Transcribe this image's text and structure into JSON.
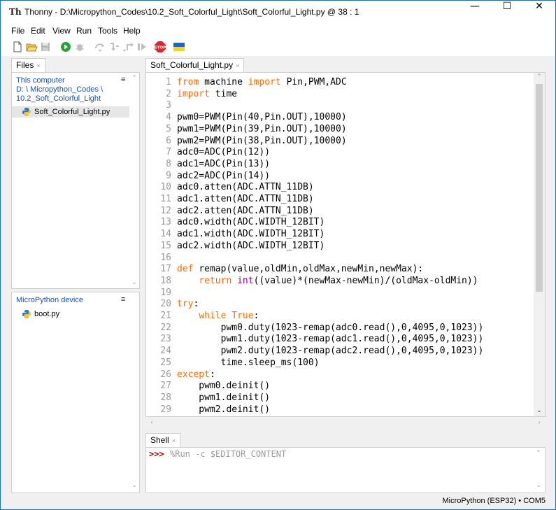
{
  "window": {
    "title": "Thonny  -  D:\\Micropython_Codes\\10.2_Soft_Colorful_Light\\Soft_Colorful_Light.py  @  38 : 1",
    "app_icon_text": "Th",
    "controls": {
      "minimize": "—",
      "maximize": "☐",
      "close": "✕"
    }
  },
  "menu": [
    "File",
    "Edit",
    "View",
    "Run",
    "Tools",
    "Help"
  ],
  "toolbar": {
    "icons": [
      "new-file-icon",
      "open-file-icon",
      "save-file-icon",
      "run-icon",
      "debug-icon",
      "step-over-icon",
      "step-into-icon",
      "step-out-icon",
      "resume-icon",
      "stop-icon",
      "ukraine-flag-icon"
    ],
    "stop_label": "STOP"
  },
  "colors": {
    "accent": "#1c4fa8",
    "keyword": "#ff6a00",
    "builtin": "#7700aa",
    "prompt": "#8b0000",
    "stop": "#d9262c"
  },
  "files_panel": {
    "tab_label": "Files",
    "tab_close": "×",
    "computer_section": {
      "title": "This computer",
      "path_line1": "D: \\ Micropython_Codes \\",
      "path_line2": "10.2_Soft_Colorful_Light",
      "files": [
        "Soft_Colorful_Light.py"
      ]
    },
    "device_section": {
      "title": "MicroPython device",
      "files": [
        "boot.py"
      ]
    },
    "menu_glyph": "≡"
  },
  "editor": {
    "tab_label": "Soft_Colorful_Light.py",
    "tab_close": "×",
    "line_numbers": [
      "1",
      "2",
      "3",
      "4",
      "5",
      "6",
      "7",
      "8",
      "9",
      "10",
      "11",
      "12",
      "13",
      "14",
      "15",
      "16",
      "17",
      "18",
      "19",
      "20",
      "21",
      "22",
      "23",
      "24",
      "25",
      "26",
      "27",
      "28",
      "29"
    ],
    "lines": [
      "from machine import Pin,PWM,ADC",
      "import time",
      "",
      "pwm0=PWM(Pin(40,Pin.OUT),10000)",
      "pwm1=PWM(Pin(39,Pin.OUT),10000)",
      "pwm2=PWM(Pin(38,Pin.OUT),10000)",
      "adc0=ADC(Pin(12))",
      "adc1=ADC(Pin(13))",
      "adc2=ADC(Pin(14))",
      "adc0.atten(ADC.ATTN_11DB)",
      "adc1.atten(ADC.ATTN_11DB)",
      "adc2.atten(ADC.ATTN_11DB)",
      "adc0.width(ADC.WIDTH_12BIT)",
      "adc1.width(ADC.WIDTH_12BIT)",
      "adc2.width(ADC.WIDTH_12BIT)",
      "",
      "def remap(value,oldMin,oldMax,newMin,newMax):",
      "    return int((value)*(newMax-newMin)/(oldMax-oldMin))",
      "",
      "try:",
      "    while True:",
      "        pwm0.duty(1023-remap(adc0.read(),0,4095,0,1023))",
      "        pwm1.duty(1023-remap(adc1.read(),0,4095,0,1023))",
      "        pwm2.duty(1023-remap(adc2.read(),0,4095,0,1023))",
      "        time.sleep_ms(100)",
      "except:",
      "    pwm0.deinit()",
      "    pwm1.deinit()",
      "    pwm2.deinit()"
    ]
  },
  "shell": {
    "tab_label": "Shell",
    "tab_close": "×",
    "prompt": ">>>",
    "command": "%Run -c $EDITOR_CONTENT"
  },
  "status": {
    "text": "MicroPython (ESP32)  •  COM5"
  }
}
